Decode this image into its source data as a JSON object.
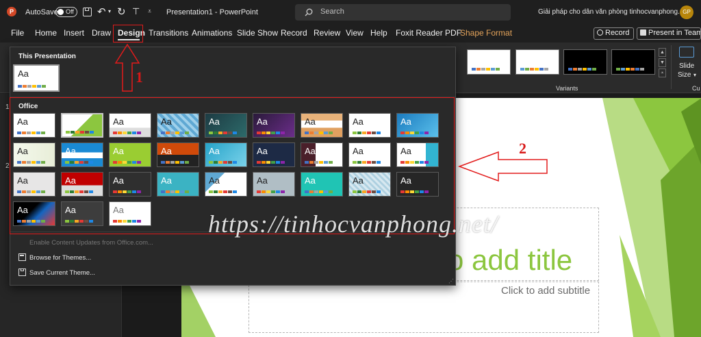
{
  "titlebar": {
    "autosave_label": "AutoSave",
    "autosave_state": "Off",
    "document_title": "Presentation1 - PowerPoint",
    "search_placeholder": "Search",
    "account_text": "Giải pháp cho dân văn phòng tinhocvanphong.net",
    "avatar_initials": "GP"
  },
  "menu": {
    "items": [
      "File",
      "Home",
      "Insert",
      "Draw",
      "Design",
      "Transitions",
      "Animations",
      "Slide Show",
      "Record",
      "Review",
      "View",
      "Help",
      "Foxit Reader PDF",
      "Shape Format"
    ],
    "active": "Design",
    "record_button": "Record",
    "present_button": "Present in Teams"
  },
  "ribbon": {
    "variants_label": "Variants",
    "slide_size_label_1": "Slide",
    "slide_size_label_2": "Size",
    "customize_label": "Cu",
    "variant_colors": [
      "#ffffff",
      "#ffffff",
      "#000000",
      "#000000"
    ]
  },
  "dropdown": {
    "this_presentation_label": "This Presentation",
    "office_label": "Office",
    "theme_glyph": "Aa",
    "enable_updates": "Enable Content Updates from Office.com...",
    "browse_themes": "Browse for Themes...",
    "save_theme": "Save Current Theme..."
  },
  "thumbnails": {
    "slide_numbers": [
      "1",
      "2"
    ]
  },
  "slide": {
    "title_placeholder": "o add title",
    "subtitle_placeholder": "Click to add subtitle",
    "accent_color": "#8cc63f"
  },
  "annotations": {
    "step1": "1",
    "step2": "2",
    "watermark": "https://tinhocvanphong.net/",
    "highlight_color": "#e21b1b"
  }
}
